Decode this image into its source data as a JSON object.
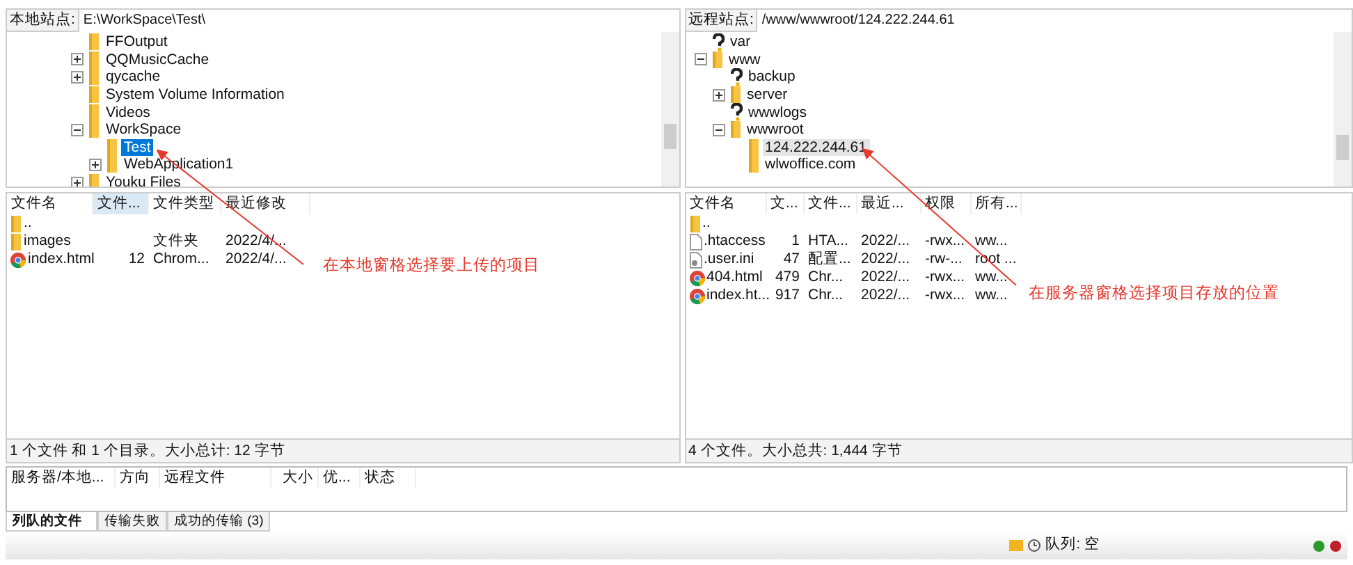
{
  "panes": [
    {
      "site_label": "本地站点:",
      "path": "E:\\WorkSpace\\Test\\",
      "active": true,
      "tree": [
        {
          "label": "FFOutput",
          "kind": "folder",
          "selected": false
        },
        {
          "label": "QQMusicCache",
          "expanded": false,
          "kind": "folder",
          "selected": false
        },
        {
          "label": "qycache",
          "expanded": false,
          "kind": "folder",
          "selected": false
        },
        {
          "label": "System Volume Information",
          "kind": "folder",
          "selected": false
        },
        {
          "label": "Videos",
          "kind": "folder",
          "selected": false
        },
        {
          "label": "WorkSpace",
          "expanded": true,
          "kind": "folder",
          "selected": false,
          "children": [
            {
              "label": "Test",
              "kind": "folder",
              "selected": true
            },
            {
              "label": "WebApplication1",
              "expanded": false,
              "kind": "folder",
              "selected": false
            }
          ]
        },
        {
          "label": "Youku Files",
          "expanded": false,
          "kind": "folder",
          "selected": false
        }
      ],
      "columns": [
        {
          "label": "文件名",
          "selected": false
        },
        {
          "label": "文件...",
          "selected": true
        },
        {
          "label": "文件类型",
          "selected": false
        },
        {
          "label": "最近修改",
          "selected": false
        }
      ],
      "rows": [
        {
          "kind": "folder",
          "cells": [
            ".."
          ]
        },
        {
          "kind": "folder",
          "cells": [
            "images",
            "",
            "文件夹",
            "2022/4/..."
          ]
        },
        {
          "kind": "browser",
          "cells": [
            "index.html",
            "12",
            "Chrom...",
            "2022/4/..."
          ]
        }
      ],
      "status": "1 个文件 和 1 个目录。大小总计: 12 字节"
    },
    {
      "site_label": "远程站点:",
      "path": "/www/wwwroot/124.222.244.61",
      "active": false,
      "tree": [
        {
          "label": "var",
          "kind": "unknown",
          "selected": false
        },
        {
          "label": "www",
          "expanded": true,
          "kind": "folder",
          "selected": false,
          "children": [
            {
              "label": "backup",
              "kind": "unknown",
              "selected": false
            },
            {
              "label": "server",
              "expanded": false,
              "kind": "folder",
              "selected": false
            },
            {
              "label": "wwwlogs",
              "kind": "unknown",
              "selected": false
            },
            {
              "label": "wwwroot",
              "expanded": true,
              "kind": "folder",
              "selected": false,
              "children": [
                {
                  "label": "124.222.244.61",
                  "kind": "folder",
                  "selected": true
                },
                {
                  "label": "wlwoffice.com",
                  "kind": "folder",
                  "selected": false
                }
              ]
            }
          ]
        }
      ],
      "columns": [
        {
          "label": "文件名",
          "selected": false
        },
        {
          "label": "文...",
          "selected": false
        },
        {
          "label": "文件...",
          "selected": false
        },
        {
          "label": "最近...",
          "selected": false
        },
        {
          "label": "权限",
          "selected": false
        },
        {
          "label": "所有...",
          "selected": false
        }
      ],
      "rows": [
        {
          "kind": "folder",
          "cells": [
            ".."
          ]
        },
        {
          "kind": "file",
          "cells": [
            ".htaccess",
            "1",
            "HTA...",
            "2022/...",
            "-rwx...",
            "ww..."
          ]
        },
        {
          "kind": "config",
          "cells": [
            ".user.ini",
            "47",
            "配置...",
            "2022/...",
            "-rw-...",
            "root ..."
          ]
        },
        {
          "kind": "browser",
          "cells": [
            "404.html",
            "479",
            "Chr...",
            "2022/...",
            "-rwx...",
            "ww..."
          ]
        },
        {
          "kind": "browser",
          "cells": [
            "index.ht...",
            "917",
            "Chr...",
            "2022/...",
            "-rwx...",
            "ww..."
          ]
        }
      ],
      "status": "4 个文件。大小总共: 1,444 字节"
    }
  ],
  "queue": {
    "columns": [
      "服务器/本地...",
      "方向",
      "远程文件",
      "大小",
      "优...",
      "状态"
    ]
  },
  "tabs": [
    {
      "label": "列队的文件",
      "selected": true
    },
    {
      "label": "传输失败",
      "selected": false
    },
    {
      "label": "成功的传输 (3)",
      "selected": false
    }
  ],
  "status_bar": {
    "queue": "队列: 空"
  },
  "annotations": [
    {
      "text": "在本地窗格选择要上传的项目"
    },
    {
      "text": "在服务器窗格选择项目存放的位置"
    }
  ]
}
